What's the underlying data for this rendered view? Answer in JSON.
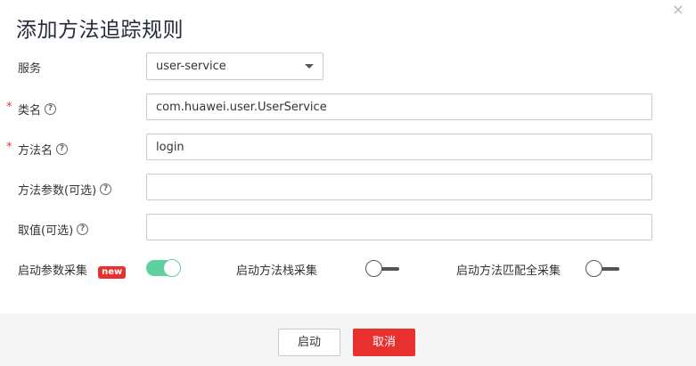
{
  "dialog": {
    "title": "添加方法追踪规则",
    "close_glyph": "×"
  },
  "form": {
    "service": {
      "label": "服务",
      "value": "user-service"
    },
    "class_name": {
      "label": "类名",
      "required_mark": "*",
      "value": "com.huawei.user.UserService"
    },
    "method_name": {
      "label": "方法名",
      "required_mark": "*",
      "value": "login"
    },
    "method_params": {
      "label": "方法参数(可选)",
      "value": ""
    },
    "value_opt": {
      "label": "取值(可选)",
      "value": ""
    },
    "help_glyph": "?"
  },
  "toggles": {
    "param_collect": {
      "label": "启动参数采集",
      "badge": "new",
      "on": true
    },
    "stack_collect": {
      "label": "启动方法栈采集",
      "on": false
    },
    "full_match_collect": {
      "label": "启动方法匹配全采集",
      "on": false
    }
  },
  "footer": {
    "start_label": "启动",
    "cancel_label": "取消"
  },
  "colors": {
    "accent_red": "#e8312f",
    "toggle_on": "#5fd1a1"
  }
}
